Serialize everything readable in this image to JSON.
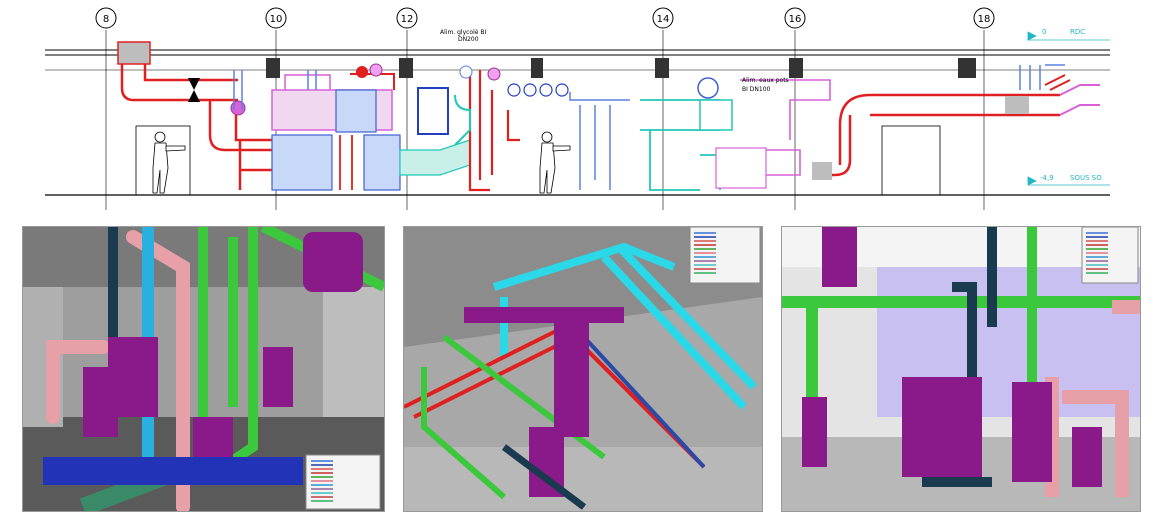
{
  "elevation": {
    "grid_labels": [
      "8",
      "10",
      "12",
      "14",
      "16",
      "18"
    ],
    "notes": {
      "alim_glycol": "Alim. glycolé BI",
      "alim_glycol_dn": "DN200",
      "alim_eau_froide": "Alim. eaux pots",
      "alim_eau_froide_dn": "BI DN100",
      "right_top_value": "0",
      "right_top_label": "RDC",
      "right_bottom_value": "-4,9",
      "right_bottom_label": "SOUS SO"
    }
  },
  "legend_lines": [
    {
      "color": "#3a6fd8"
    },
    {
      "color": "#1a3fa8"
    },
    {
      "color": "#d85050"
    },
    {
      "color": "#c03030"
    },
    {
      "color": "#30a030"
    },
    {
      "color": "#e07080"
    },
    {
      "color": "#3090d0"
    },
    {
      "color": "#906090"
    },
    {
      "color": "#40c0c0"
    },
    {
      "color": "#c04040"
    },
    {
      "color": "#30b060"
    }
  ],
  "colors": {
    "duct_red": "#e02020",
    "duct_pink": "#d860d8",
    "duct_blue": "#4060d0",
    "duct_cyan": "#20c8b8",
    "pipe_purple": "#8a1a8a",
    "pipe_green": "#3cc83c",
    "pipe_pink": "#e8a0a8",
    "pipe_cyan": "#2ad8e8",
    "pipe_navy": "#1a3a50"
  }
}
